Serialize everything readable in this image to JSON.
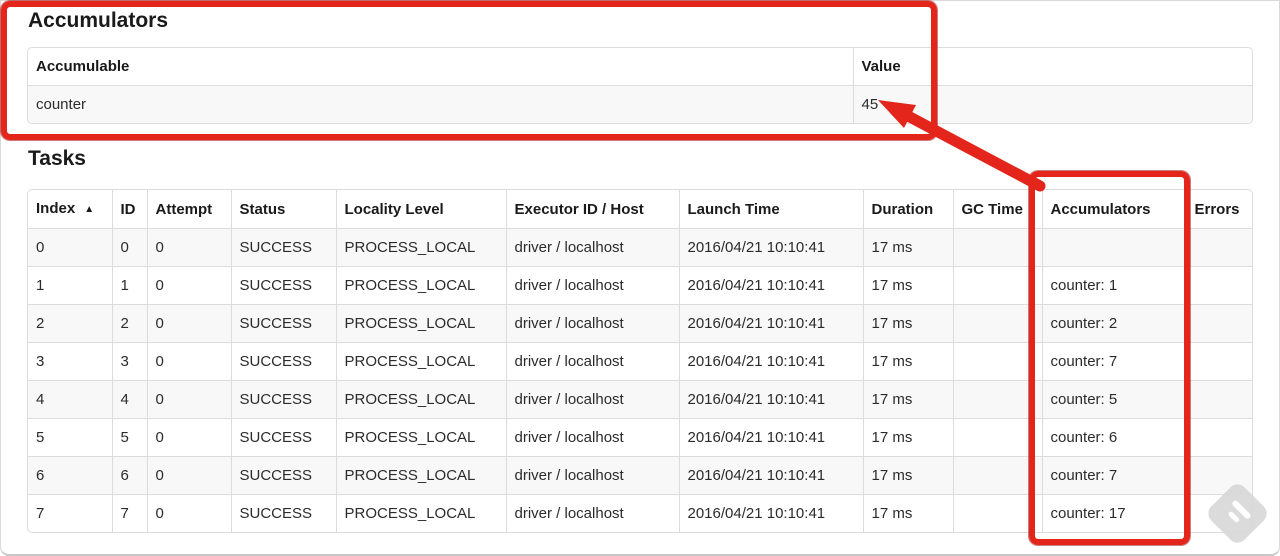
{
  "accumulators_section": {
    "title": "Accumulators",
    "headers": [
      "Accumulable",
      "Value"
    ],
    "rows": [
      [
        "counter",
        "45"
      ]
    ]
  },
  "tasks_section": {
    "title": "Tasks",
    "headers": [
      "Index",
      "ID",
      "Attempt",
      "Status",
      "Locality Level",
      "Executor ID / Host",
      "Launch Time",
      "Duration",
      "GC Time",
      "Accumulators",
      "Errors"
    ],
    "sort": {
      "column": "Index",
      "direction": "ascending",
      "icon": "▲"
    },
    "rows": [
      [
        "0",
        "0",
        "0",
        "SUCCESS",
        "PROCESS_LOCAL",
        "driver / localhost",
        "2016/04/21 10:10:41",
        "17 ms",
        "",
        "",
        ""
      ],
      [
        "1",
        "1",
        "0",
        "SUCCESS",
        "PROCESS_LOCAL",
        "driver / localhost",
        "2016/04/21 10:10:41",
        "17 ms",
        "",
        "counter: 1",
        ""
      ],
      [
        "2",
        "2",
        "0",
        "SUCCESS",
        "PROCESS_LOCAL",
        "driver / localhost",
        "2016/04/21 10:10:41",
        "17 ms",
        "",
        "counter: 2",
        ""
      ],
      [
        "3",
        "3",
        "0",
        "SUCCESS",
        "PROCESS_LOCAL",
        "driver / localhost",
        "2016/04/21 10:10:41",
        "17 ms",
        "",
        "counter: 7",
        ""
      ],
      [
        "4",
        "4",
        "0",
        "SUCCESS",
        "PROCESS_LOCAL",
        "driver / localhost",
        "2016/04/21 10:10:41",
        "17 ms",
        "",
        "counter: 5",
        ""
      ],
      [
        "5",
        "5",
        "0",
        "SUCCESS",
        "PROCESS_LOCAL",
        "driver / localhost",
        "2016/04/21 10:10:41",
        "17 ms",
        "",
        "counter: 6",
        ""
      ],
      [
        "6",
        "6",
        "0",
        "SUCCESS",
        "PROCESS_LOCAL",
        "driver / localhost",
        "2016/04/21 10:10:41",
        "17 ms",
        "",
        "counter: 7",
        ""
      ],
      [
        "7",
        "7",
        "0",
        "SUCCESS",
        "PROCESS_LOCAL",
        "driver / localhost",
        "2016/04/21 10:10:41",
        "17 ms",
        "",
        "counter: 17",
        ""
      ]
    ]
  },
  "annotations": {
    "highlight_color": "#e4251b",
    "rectangles": [
      "accumulator-summary",
      "accumulators-task-column"
    ],
    "arrow_points_to": "45"
  }
}
